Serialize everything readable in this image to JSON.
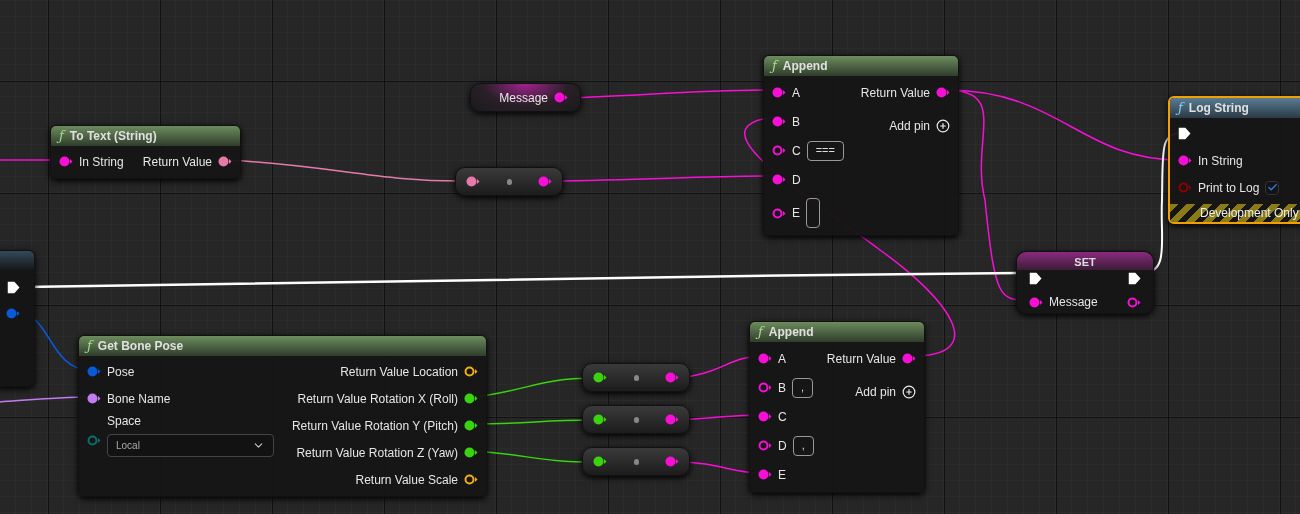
{
  "nodes": [
    {
      "kind": "partial",
      "selected": false,
      "outputs": [
        {
          "kind": "exec",
          "linked": true
        },
        {
          "kind": "struct",
          "linked": true
        }
      ]
    },
    {
      "kind": "function",
      "title": "To Text (String)",
      "icon": "ƒ",
      "pure": true,
      "selected": false,
      "inputs": [
        {
          "label": "In String",
          "kind": "string",
          "linked": true
        }
      ],
      "outputs": [
        {
          "label": "Return Value",
          "kind": "text",
          "linked": true
        }
      ]
    },
    {
      "kind": "variable_get",
      "selected": false,
      "outputs": [
        {
          "label": "Message",
          "kind": "string",
          "linked": true
        }
      ]
    },
    {
      "kind": "conversion",
      "selected": false,
      "inputs": [
        {
          "kind": "text",
          "linked": true
        }
      ],
      "outputs": [
        {
          "kind": "string",
          "linked": true
        }
      ]
    },
    {
      "kind": "function",
      "title": "Append",
      "icon": "ƒ",
      "pure": true,
      "selected": false,
      "add_pin": "Add pin",
      "inputs": [
        {
          "label": "A",
          "kind": "string",
          "linked": true
        },
        {
          "label": "B",
          "kind": "string",
          "linked": true
        },
        {
          "label": "C",
          "kind": "string",
          "linked": false,
          "field": true,
          "value": "==="
        },
        {
          "label": "D",
          "kind": "string",
          "linked": true
        },
        {
          "label": "E",
          "kind": "string",
          "linked": false,
          "field": true
        }
      ],
      "outputs": [
        {
          "label": "Return Value",
          "kind": "string",
          "linked": true
        }
      ]
    },
    {
      "kind": "function",
      "title": "Log String",
      "icon": "ƒ",
      "pure": false,
      "selected": true,
      "footer": "Development Only",
      "inputs": [
        {
          "kind": "exec",
          "linked": true
        },
        {
          "label": "In String",
          "kind": "string",
          "linked": true
        },
        {
          "label": "Print to Log",
          "kind": "bool",
          "linked": false,
          "checked": true
        }
      ]
    },
    {
      "kind": "variable_set",
      "title": "SET",
      "selected": false,
      "inputs": [
        {
          "kind": "exec",
          "linked": true
        },
        {
          "label": "Message",
          "kind": "string",
          "linked": true
        }
      ],
      "outputs": [
        {
          "kind": "exec",
          "linked": true
        },
        {
          "kind": "string",
          "linked": false
        }
      ]
    },
    {
      "kind": "function",
      "title": "Get Bone Pose",
      "icon": "ƒ",
      "pure": true,
      "selected": false,
      "inputs": [
        {
          "label": "Pose",
          "kind": "struct",
          "linked": true
        },
        {
          "label": "Bone Name",
          "kind": "name",
          "linked": true
        },
        {
          "label": "Space",
          "kind": "enum",
          "linked": false,
          "dropdown": "Local"
        }
      ],
      "outputs": [
        {
          "label": "Return Value Location",
          "kind": "vector",
          "linked": false
        },
        {
          "label": "Return Value Rotation X (Roll)",
          "kind": "float",
          "linked": true
        },
        {
          "label": "Return Value Rotation Y (Pitch)",
          "kind": "float",
          "linked": true
        },
        {
          "label": "Return Value Rotation Z (Yaw)",
          "kind": "float",
          "linked": true
        },
        {
          "label": "Return Value Scale",
          "kind": "vector",
          "linked": false
        }
      ]
    },
    {
      "kind": "conversion",
      "selected": false,
      "inputs": [
        {
          "kind": "float",
          "linked": true
        }
      ],
      "outputs": [
        {
          "kind": "string",
          "linked": true
        }
      ]
    },
    {
      "kind": "conversion",
      "selected": false,
      "inputs": [
        {
          "kind": "float",
          "linked": true
        }
      ],
      "outputs": [
        {
          "kind": "string",
          "linked": true
        }
      ]
    },
    {
      "kind": "conversion",
      "selected": false,
      "inputs": [
        {
          "kind": "float",
          "linked": true
        }
      ],
      "outputs": [
        {
          "kind": "string",
          "linked": true
        }
      ]
    },
    {
      "kind": "function",
      "title": "Append",
      "icon": "ƒ",
      "pure": true,
      "selected": false,
      "add_pin": "Add pin",
      "inputs": [
        {
          "label": "A",
          "kind": "string",
          "linked": true
        },
        {
          "label": "B",
          "kind": "string",
          "linked": false,
          "field": true,
          "value": ","
        },
        {
          "label": "C",
          "kind": "string",
          "linked": true
        },
        {
          "label": "D",
          "kind": "string",
          "linked": false,
          "field": true,
          "value": ","
        },
        {
          "label": "E",
          "kind": "string",
          "linked": true
        }
      ],
      "outputs": [
        {
          "label": "Return Value",
          "kind": "string",
          "linked": true
        }
      ]
    }
  ]
}
